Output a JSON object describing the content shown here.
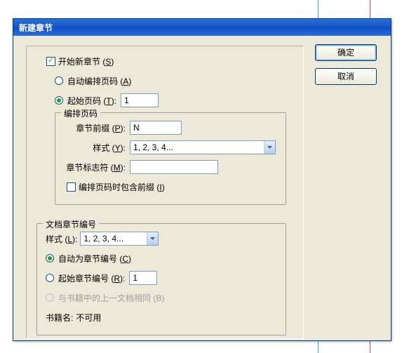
{
  "dialog": {
    "title": "新建章节"
  },
  "buttons": {
    "ok": "确定",
    "cancel": "取消"
  },
  "topSection": {
    "startNewChapter": {
      "label_pre": "开始新章节 (",
      "hotkey": "S",
      "label_post": ")",
      "checked": true
    },
    "autoNumber": {
      "label_pre": "自动编排页码 (",
      "hotkey": "A",
      "label_post": ")",
      "selected": false
    },
    "startPage": {
      "label_pre": "起始页码 (",
      "hotkey": "T",
      "label_post": "):",
      "selected": true,
      "value": "1"
    }
  },
  "numbering": {
    "legend": "编排页码",
    "prefix": {
      "label_pre": "章节前缀 (",
      "hotkey": "P",
      "label_post": "):",
      "value": "N"
    },
    "style": {
      "label_pre": "样式 (",
      "hotkey": "Y",
      "label_post": "):",
      "value": "1, 2, 3, 4..."
    },
    "marker": {
      "label_pre": "章节标志符 (",
      "hotkey": "M",
      "label_post": "):",
      "value": ""
    },
    "includePrefix": {
      "label_pre": "编排页码时包含前缀 (",
      "hotkey": "I",
      "label_post": ")",
      "checked": false
    }
  },
  "docSection": {
    "legend": "文档章节编号",
    "style": {
      "label_pre": "样式 (",
      "hotkey": "L",
      "label_post": "):",
      "value": "1, 2, 3, 4..."
    },
    "autoChapter": {
      "label_pre": "自动为章节编号 (",
      "hotkey": "C",
      "label_post": ")",
      "selected": true
    },
    "startChapter": {
      "label_pre": "起始章节编号 (",
      "hotkey": "R",
      "label_post": "):",
      "selected": false,
      "value": "1"
    },
    "sameAsBook": {
      "label_pre": "与书籍中的上一文档相同 (",
      "hotkey": "B",
      "label_post": ")"
    },
    "bookName": {
      "label": "书籍名:",
      "value": "不可用"
    }
  }
}
